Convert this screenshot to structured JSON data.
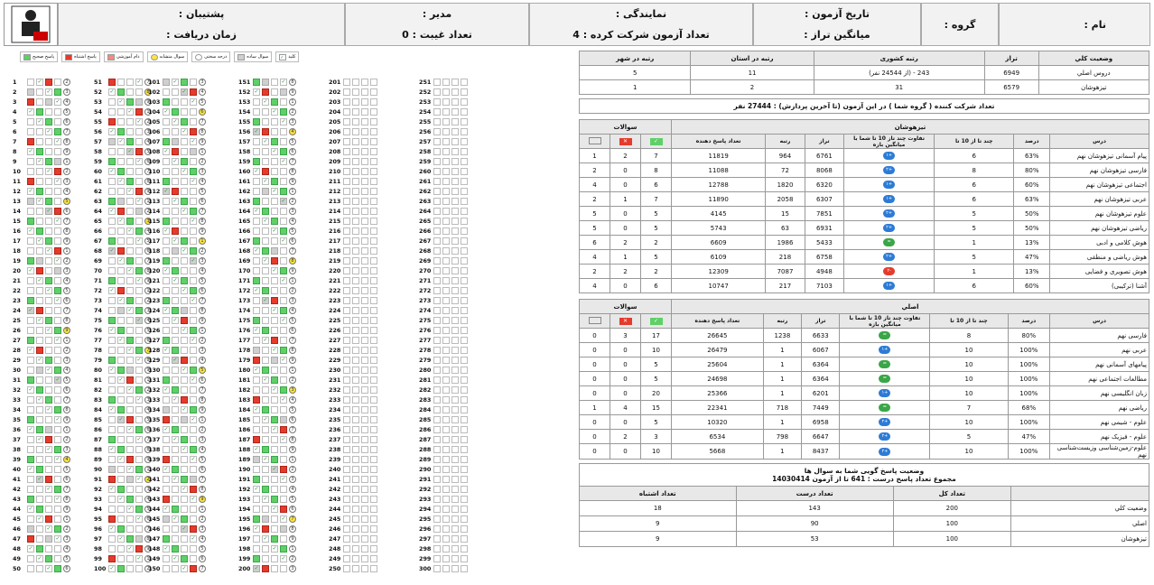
{
  "header": {
    "name_label": "نام :",
    "group_label": "گروه :",
    "exam_date_label": "تاریخ آزمون :",
    "avg_taraz_label": "میانگین تراز :",
    "rep_label": "نمایندگی :",
    "count_label": "تعداد آزمون شرکت کرده : 4",
    "manager_label": "مدیر :",
    "absent_label": "تعداد غیبت : 0",
    "support_label": "پشتیبان :",
    "receive_label": "زمان دریافت :",
    "logo_text": "دفترچه آموزش"
  },
  "legend": [
    "کلید",
    "سوال ساده",
    "درجه سختی",
    "سوال متشابه",
    "دام آموزشی",
    "پاسخ اشتباه",
    "پاسخ صحیح"
  ],
  "rank_table": {
    "headers": [
      "وضعيت کلي",
      "تراز",
      "رتبه کشوری",
      "رتبه در استان",
      "رتبه در شهر"
    ],
    "rows": [
      [
        "دروس اصلي",
        "6949",
        "243  - (از 24544 نفر)",
        "11",
        "5"
      ],
      [
        "تيزهوشان",
        "6579",
        "31",
        "2",
        "1"
      ]
    ]
  },
  "participants": "تعداد شرکت کننده ( گروه شما ) در این آزمون (تا آخرین پردازش) : 27444 نفر",
  "tiz": {
    "group_title": "تیزهوشان",
    "questions_title": "سوالات",
    "headers": [
      "درس",
      "درصد",
      "چند تا از 10 تا",
      "تفاوت چند تاز 10 تا شما با میانگین بازه",
      "تراز",
      "رتبه",
      "تعداد پاسخ دهنده"
    ],
    "rows": [
      [
        "پیام آسمانی تیزهوشان نهم",
        "63%",
        "6",
        "+۱",
        "6761",
        "964",
        "11819",
        "7",
        "2",
        "1",
        "b"
      ],
      [
        "فارسی تیزهوشان نهم",
        "80%",
        "8",
        "+۲",
        "8068",
        "72",
        "11088",
        "8",
        "0",
        "2",
        "b"
      ],
      [
        "اجتماعی تیزهوشان نهم",
        "60%",
        "6",
        "+۱",
        "6320",
        "1820",
        "12788",
        "6",
        "0",
        "4",
        "b"
      ],
      [
        "عربی تیزهوشان نهم",
        "63%",
        "6",
        "+۱",
        "6307",
        "2058",
        "11890",
        "7",
        "1",
        "2",
        "b"
      ],
      [
        "علوم تیزهوشان نهم",
        "50%",
        "5",
        "+۲",
        "7851",
        "15",
        "4145",
        "5",
        "0",
        "5",
        "b"
      ],
      [
        "ریاضی تیزهوشان نهم",
        "50%",
        "5",
        "+۲",
        "6931",
        "63",
        "5743",
        "5",
        "0",
        "5",
        "b"
      ],
      [
        "هوش کلامی و ادبی",
        "13%",
        "1",
        "=",
        "5433",
        "1986",
        "6609",
        "2",
        "2",
        "6",
        "gg"
      ],
      [
        "هوش ریاضی و منطقی",
        "47%",
        "5",
        "+۲",
        "6758",
        "218",
        "6109",
        "5",
        "1",
        "4",
        "b"
      ],
      [
        "هوش تصویری و فضایی",
        "13%",
        "1",
        "-۲",
        "4948",
        "7087",
        "12309",
        "2",
        "2",
        "2",
        "rr"
      ],
      [
        "آشنا (ترکیبی)",
        "60%",
        "6",
        "+۱",
        "7103",
        "217",
        "10747",
        "6",
        "0",
        "4",
        "b"
      ]
    ]
  },
  "asli": {
    "group_title": "اصلي",
    "questions_title": "سوالات",
    "headers": [
      "درس",
      "درصد",
      "چند تا از 10 تا",
      "تفاوت چند تاز 10 تا شما با میانگین بازه",
      "تراز",
      "رتبه",
      "تعداد پاسخ دهنده"
    ],
    "rows": [
      [
        "فارسی نهم",
        "80%",
        "8",
        "=",
        "6633",
        "1238",
        "26645",
        "17",
        "3",
        "0",
        "gg"
      ],
      [
        "عربی نهم",
        "100%",
        "10",
        "+۱",
        "6067",
        "1",
        "26479",
        "10",
        "0",
        "0",
        "b"
      ],
      [
        "پیامهای آسمانی نهم",
        "100%",
        "10",
        "=",
        "6364",
        "1",
        "25604",
        "5",
        "0",
        "0",
        "gg"
      ],
      [
        "مطالعات اجتماعی نهم",
        "100%",
        "10",
        "=",
        "6364",
        "1",
        "24698",
        "5",
        "0",
        "0",
        "gg"
      ],
      [
        "زبان انگلیسی نهم",
        "100%",
        "10",
        "+۱",
        "6201",
        "1",
        "25366",
        "20",
        "0",
        "0",
        "b"
      ],
      [
        "ریاضی نهم",
        "68%",
        "7",
        "=",
        "7449",
        "718",
        "22341",
        "15",
        "4",
        "1",
        "gg"
      ],
      [
        "علوم - شیمی نهم",
        "100%",
        "10",
        "+۲",
        "6958",
        "1",
        "10320",
        "5",
        "0",
        "0",
        "b"
      ],
      [
        "علوم - فیزیک نهم",
        "47%",
        "5",
        "+۲",
        "6647",
        "798",
        "6534",
        "3",
        "2",
        "0",
        "b"
      ],
      [
        "علوم-زمین‌شناسی وزیست‌شناسی نهم",
        "100%",
        "10",
        "+۲",
        "8437",
        "1",
        "5668",
        "10",
        "0",
        "0",
        "b"
      ]
    ]
  },
  "status": {
    "title": "وضعیت پاسخ گویی شما به سوال ها",
    "subtitle": "مجموع تعداد پاسخ درست : 641 تا از آزمون 14030414",
    "headers": [
      "",
      "تعداد کل",
      "تعداد درست",
      "تعداد اشتباه"
    ],
    "rows": [
      [
        "وضعیت کلي",
        "200",
        "143",
        "18"
      ],
      [
        "اصلي",
        "100",
        "90",
        "9"
      ],
      [
        "تیزهوشان",
        "100",
        "53",
        "9"
      ]
    ]
  },
  "answers": {
    "1": [
      0,
      0,
      0,
      0,
      0
    ],
    "51": [
      1,
      0,
      0,
      0,
      1
    ],
    "101": [
      1,
      0,
      0,
      0,
      1
    ],
    "151": [
      1,
      0,
      0,
      0,
      1
    ],
    "201": [
      2,
      0,
      0,
      0,
      1
    ],
    "2": [
      0,
      1,
      0,
      1,
      0
    ],
    "52": [
      2,
      0,
      0,
      0,
      0
    ],
    "102": [
      3,
      0,
      0,
      0,
      0
    ],
    "152": [
      2,
      0,
      0,
      0,
      0
    ],
    "202": [
      3,
      0,
      0,
      2,
      0
    ],
    "3": [
      0,
      0,
      0,
      1,
      0
    ],
    "53": [
      2,
      0,
      0,
      0,
      1
    ],
    "103": [
      1,
      0,
      0,
      0,
      0
    ],
    "153": [
      1,
      0,
      0,
      0,
      0
    ],
    "203": [
      1,
      0,
      0,
      0,
      0
    ],
    "4": [
      0,
      0,
      0,
      0,
      1
    ],
    "54": [
      1,
      1,
      0,
      0,
      1
    ],
    "104": [
      1,
      0,
      0,
      0,
      0
    ],
    "154": [
      1,
      0,
      0,
      0,
      1
    ],
    "204": [
      1,
      0,
      0,
      0,
      0
    ],
    "5": [
      1,
      0,
      0,
      1,
      1
    ],
    "55": [
      1,
      0,
      0,
      0,
      1
    ],
    "105": [
      1,
      0,
      0,
      0,
      1
    ],
    "155": [
      2,
      0,
      0,
      0,
      0
    ],
    "205": [
      2,
      0,
      0,
      0,
      0
    ],
    "6": [
      0,
      0,
      0,
      0,
      1
    ],
    "56": [
      2,
      0,
      0,
      1,
      0
    ],
    "106": [
      1,
      0,
      0,
      0,
      2
    ],
    "156": [
      1,
      0,
      0,
      0,
      1
    ],
    "206": [
      1,
      0,
      0,
      0,
      0
    ],
    "7": [
      0,
      0,
      0,
      0,
      1
    ],
    "57": [
      1,
      0,
      0,
      0,
      1
    ],
    "107": [
      1,
      0,
      0,
      1,
      0
    ],
    "157": [
      1,
      0,
      0,
      0,
      1
    ],
    "207": [
      1,
      0,
      0,
      0,
      0
    ],
    "8": [
      0,
      0,
      0,
      0,
      1
    ],
    "58": [
      1,
      0,
      0,
      0,
      1
    ],
    "108": [
      1,
      0,
      0,
      0,
      1
    ],
    "158": [
      1,
      0,
      0,
      0,
      0
    ],
    "208": [
      2,
      0,
      0,
      0,
      0
    ],
    "9": [
      1,
      0,
      0,
      0,
      1
    ],
    "59": [
      1,
      0,
      0,
      0,
      1
    ],
    "109": [
      1,
      0,
      0,
      0,
      2
    ],
    "159": [
      2,
      0,
      0,
      0,
      1
    ],
    "209": [
      1,
      0,
      0,
      0,
      0
    ],
    "10": [
      0,
      0,
      0,
      0,
      1
    ],
    "60": [
      1,
      0,
      0,
      0,
      1
    ],
    "110": [
      1,
      0,
      0,
      0,
      1
    ],
    "160": [
      2,
      0,
      0,
      0,
      0
    ],
    "210": [
      1,
      0,
      0,
      0,
      0
    ]
  }
}
